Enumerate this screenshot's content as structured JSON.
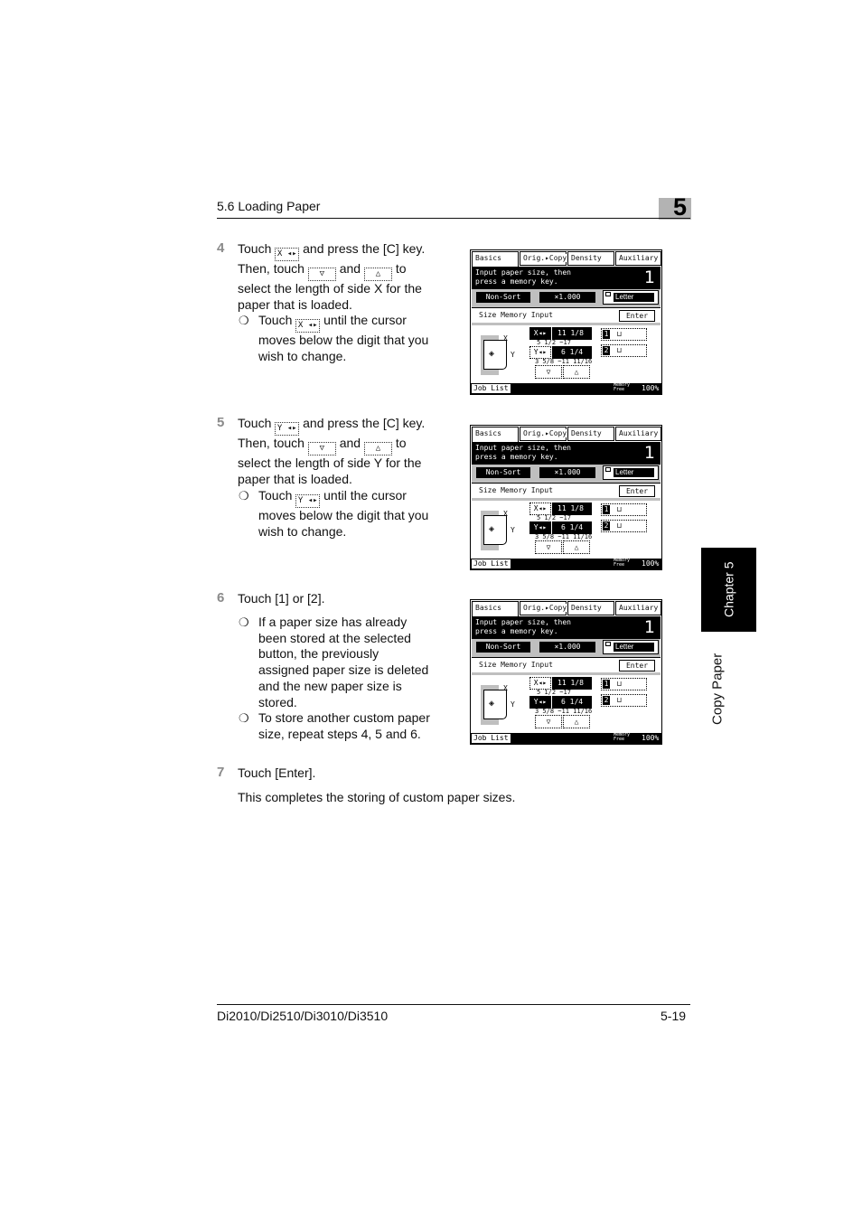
{
  "header": {
    "section_title": "5.6 Loading Paper",
    "chapter_number": "5"
  },
  "steps": [
    {
      "number": "4",
      "lines": [
        "Touch",
        "and press the [C] key.",
        "Then, touch",
        "and",
        "to",
        "select the length of side X for the",
        "paper that is loaded."
      ],
      "inline_buttons": {
        "axis": "X ◂▸",
        "down": "▽",
        "up": "△"
      },
      "bullets": [
        {
          "parts": [
            "Touch",
            "until the cursor",
            "moves below the digit that you",
            "wish to change."
          ],
          "button": "X ◂▸"
        }
      ]
    },
    {
      "number": "5",
      "lines": [
        "Touch",
        "and press the [C] key.",
        "Then, touch",
        "and",
        "to",
        "select the length of side Y for the",
        "paper that is loaded."
      ],
      "inline_buttons": {
        "axis": "Y ◂▸",
        "down": "▽",
        "up": "△"
      },
      "bullets": [
        {
          "parts": [
            "Touch",
            "until the cursor",
            "moves below the digit that you",
            "wish to change."
          ],
          "button": "Y ◂▸"
        }
      ]
    },
    {
      "number": "6",
      "lines": [
        "Touch [1] or [2]."
      ],
      "bullets": [
        {
          "lines": [
            "If a paper size has already",
            "been stored at the selected",
            "button, the previously",
            "assigned paper size is deleted",
            "and the new paper size is",
            "stored."
          ]
        },
        {
          "lines": [
            "To store another custom paper",
            "size, repeat steps 4, 5 and 6."
          ]
        }
      ]
    },
    {
      "number": "7",
      "lines": [
        "Touch [Enter]."
      ],
      "note": "This completes the storing of custom paper sizes."
    }
  ],
  "panel": {
    "tabs": [
      "Basics",
      "Orig.▸Copy",
      "Density",
      "Auxiliary"
    ],
    "message_line1": "Input paper size, then",
    "message_line2": "press a memory key.",
    "copy_count": "1",
    "sort_label": "Non-Sort",
    "zoom_value": "×1.000",
    "paper_label": "Letter",
    "section_title": "Size Memory Input",
    "enter_label": "Enter",
    "x_button": "X◂▸",
    "y_button": "Y◂▸",
    "x_value": "11 1/8",
    "y_value": "6 1/4",
    "x_range": "5 1/2 ~17",
    "y_range": "3 5/8 ~11 11/16",
    "axis_x": "X",
    "axis_y": "Y",
    "memory_1": "1",
    "memory_2": "2",
    "job_list": "Job List",
    "memory_label_1": "Memory",
    "memory_label_2": "Free",
    "memory_value": "100%"
  },
  "panels_state": [
    {
      "active_axis": "x"
    },
    {
      "active_axis": "y"
    },
    {
      "active_axis": "y"
    }
  ],
  "side_tab": {
    "chapter": "Chapter 5",
    "section": "Copy Paper"
  },
  "footer": {
    "models": "Di2010/Di2510/Di3010/Di3510",
    "page": "5-19"
  }
}
